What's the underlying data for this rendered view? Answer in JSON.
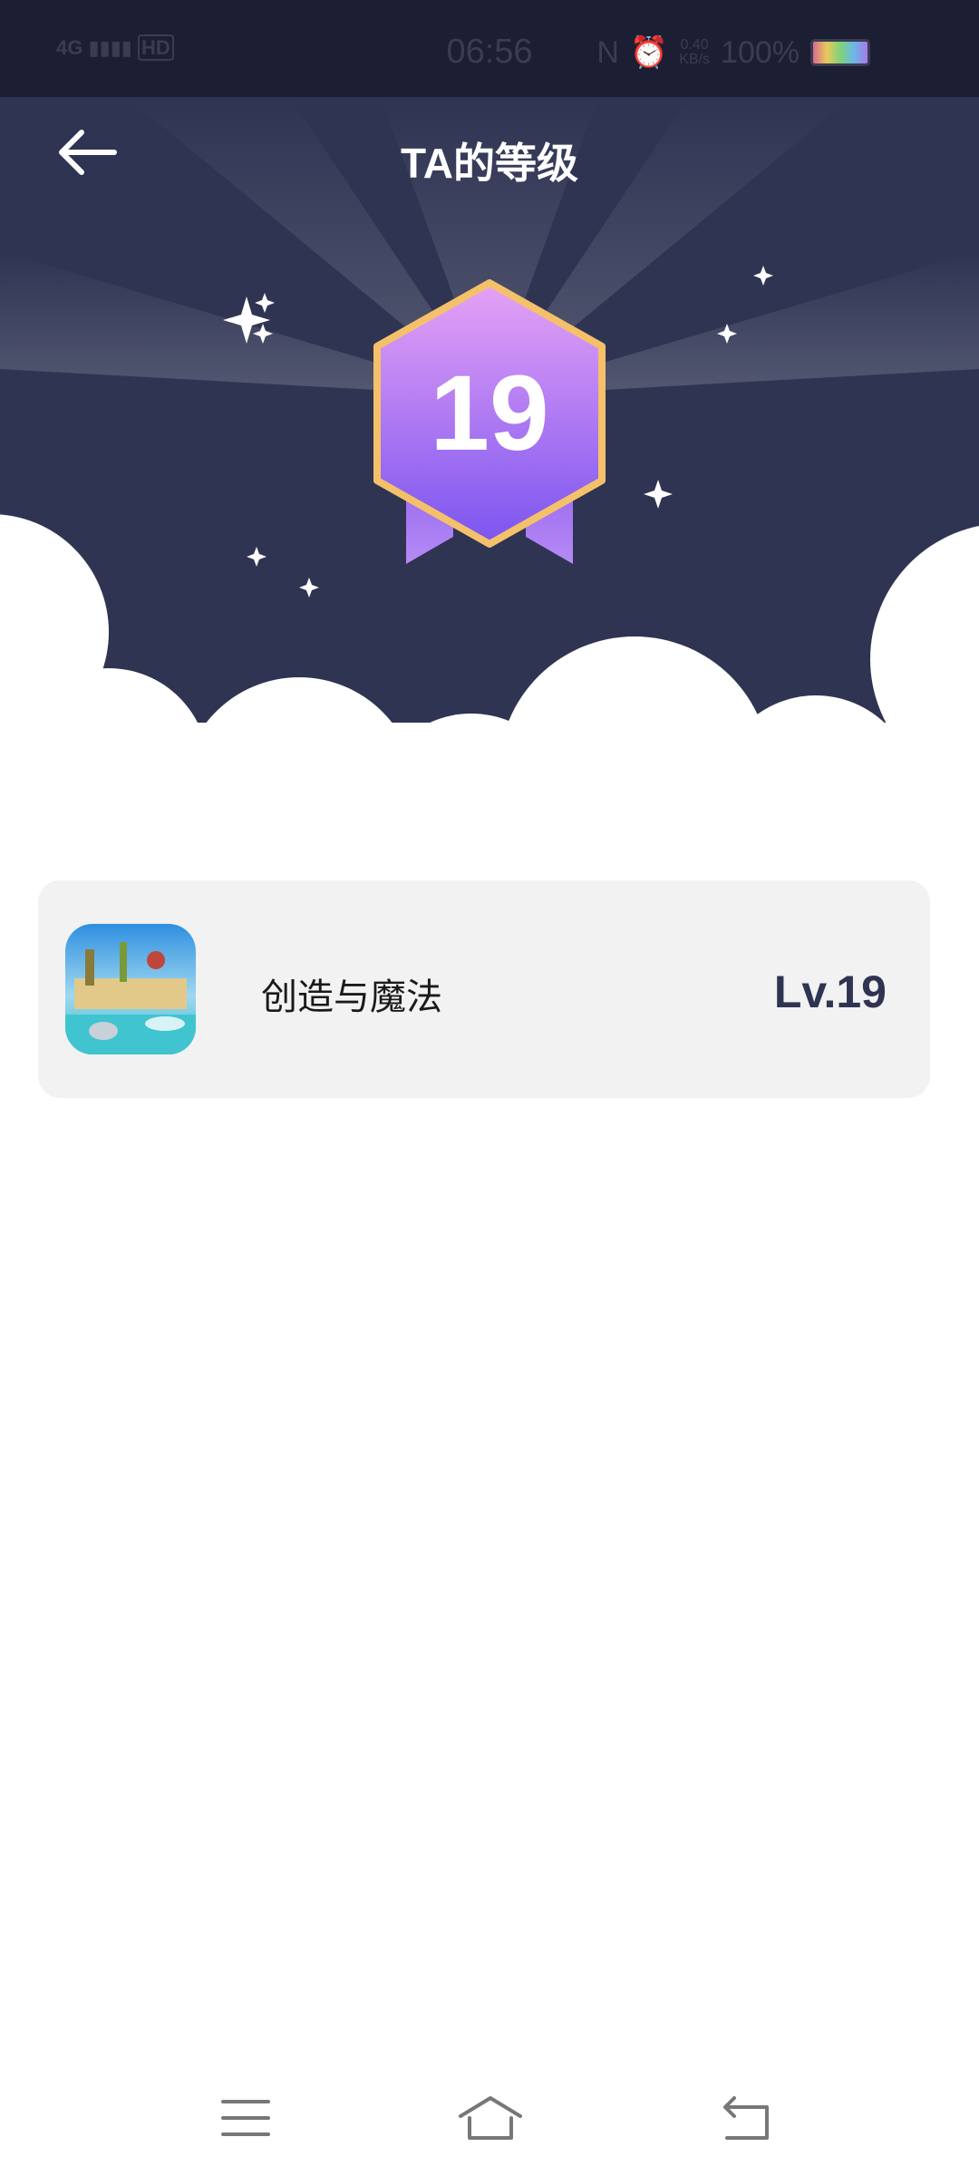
{
  "status_bar": {
    "network": "4G",
    "hd_badge": "HD",
    "time": "06:56",
    "speed_value": "0.40",
    "speed_unit": "KB/s",
    "battery": "100%",
    "icons": [
      "signal-icon",
      "nfc-icon",
      "alarm-icon",
      "battery-icon"
    ]
  },
  "header": {
    "title": "TA的等级",
    "back_icon": "arrow-left-icon"
  },
  "badge": {
    "level": "19"
  },
  "games": [
    {
      "name": "创造与魔法",
      "level": "Lv.19",
      "icon": "game-app-icon"
    }
  ],
  "nav_bar": {
    "icons": [
      "menu-icon",
      "home-icon",
      "back-icon"
    ]
  },
  "colors": {
    "header_bg": "#2f3453",
    "badge_top": "#e6a2f5",
    "badge_bottom": "#7b55f0",
    "badge_border": "#f4c16a",
    "level_text": "#2f3453",
    "card_bg": "#f2f2f2"
  }
}
